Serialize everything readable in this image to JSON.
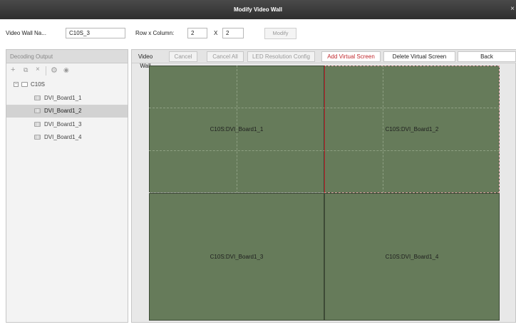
{
  "window": {
    "title": "Modify Video Wall",
    "close_glyph": "×"
  },
  "form": {
    "name_label": "Video Wall Na...",
    "name_value": "C10S_3",
    "rowcol_label": "Row x Column:",
    "rows": "2",
    "x_label": "X",
    "cols": "2",
    "modify_label": "Modify"
  },
  "left": {
    "header": "Decoding Output",
    "tools": [
      "plus-icon",
      "copy-icon",
      "delete-icon",
      "settings-icon",
      "view-icon"
    ],
    "tree": {
      "root": "C10S",
      "children": [
        "DVI_Board1_1",
        "DVI_Board1_2",
        "DVI_Board1_3",
        "DVI_Board1_4"
      ],
      "selected": "DVI_Board1_2"
    }
  },
  "toolbar": {
    "video_wall": "Video Wall",
    "cancel": "Cancel",
    "cancel_all": "Cancel All",
    "led_config": "LED Resolution Config",
    "add_virtual": "Add Virtual Screen",
    "delete_virtual": "Delete Virtual Screen",
    "back": "Back"
  },
  "wall": {
    "screens": [
      "C10S:DVI_Board1_1",
      "C10S:DVI_Board1_2",
      "C10S:DVI_Board1_3",
      "C10S:DVI_Board1_4"
    ],
    "screen_color": "#667b5a",
    "highlight_color": "#c0282d"
  }
}
